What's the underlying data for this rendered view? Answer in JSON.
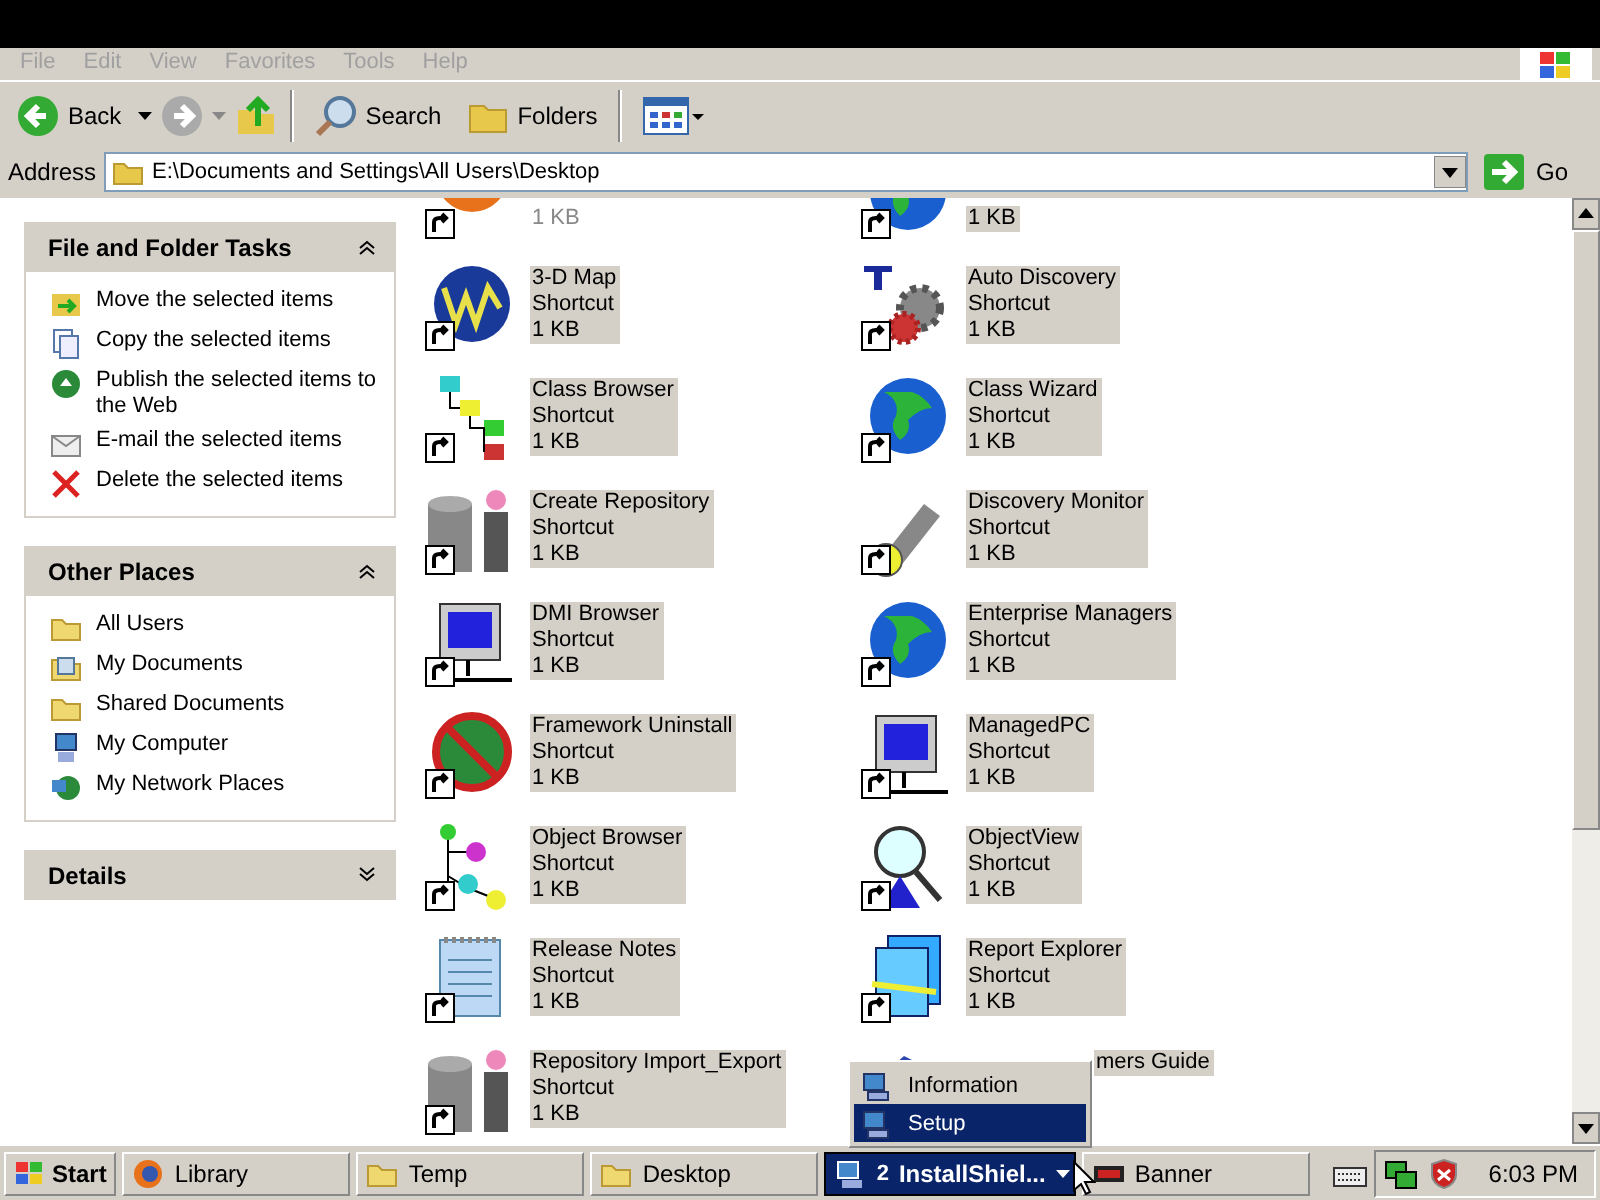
{
  "menu_bar": [
    "File",
    "Edit",
    "View",
    "Favorites",
    "Tools",
    "Help"
  ],
  "toolbar": {
    "back": "Back",
    "search": "Search",
    "folders": "Folders"
  },
  "address_bar": {
    "label": "Address",
    "value": "E:\\Documents and Settings\\All Users\\Desktop",
    "go": "Go"
  },
  "task_panes": [
    {
      "title": "File and Folder Tasks",
      "expanded": true,
      "items": [
        "Move the selected items",
        "Copy the selected items",
        "Publish the selected items to the Web",
        "E-mail the selected items",
        "Delete the selected items"
      ]
    },
    {
      "title": "Other Places",
      "expanded": true,
      "items": [
        "All Users",
        "My Documents",
        "Shared Documents",
        "My Computer",
        "My Network Places"
      ]
    },
    {
      "title": "Details",
      "expanded": false
    }
  ],
  "files": [
    {
      "size": "1 KB",
      "selected": false
    },
    {
      "size": "1 KB",
      "selected": true
    },
    {
      "name": "3-D Map",
      "type": "Shortcut",
      "size": "1 KB",
      "selected": true
    },
    {
      "name": "Auto Discovery",
      "type": "Shortcut",
      "size": "1 KB",
      "selected": true
    },
    {
      "name": "Class Browser",
      "type": "Shortcut",
      "size": "1 KB",
      "selected": true
    },
    {
      "name": "Class Wizard",
      "type": "Shortcut",
      "size": "1 KB",
      "selected": true
    },
    {
      "name": "Create Repository",
      "type": "Shortcut",
      "size": "1 KB",
      "selected": true
    },
    {
      "name": "Discovery Monitor",
      "type": "Shortcut",
      "size": "1 KB",
      "selected": true
    },
    {
      "name": "DMI Browser",
      "type": "Shortcut",
      "size": "1 KB",
      "selected": true
    },
    {
      "name": "Enterprise Managers",
      "type": "Shortcut",
      "size": "1 KB",
      "selected": true
    },
    {
      "name": "Framework Uninstall",
      "type": "Shortcut",
      "size": "1 KB",
      "selected": true
    },
    {
      "name": "ManagedPC",
      "type": "Shortcut",
      "size": "1 KB",
      "selected": true
    },
    {
      "name": "Object Browser",
      "type": "Shortcut",
      "size": "1 KB",
      "selected": true
    },
    {
      "name": "ObjectView",
      "type": "Shortcut",
      "size": "1 KB",
      "selected": true
    },
    {
      "name": "Release Notes",
      "type": "Shortcut",
      "size": "1 KB",
      "selected": true
    },
    {
      "name": "Report Explorer",
      "type": "Shortcut",
      "size": "1 KB",
      "selected": true
    },
    {
      "name": "Repository Import_Export",
      "type": "Shortcut",
      "size": "1 KB",
      "selected": true
    },
    {
      "name": "mers Guide",
      "selected": true
    }
  ],
  "context_menu": [
    {
      "label": "Information",
      "selected": false
    },
    {
      "label": "Setup",
      "selected": true
    }
  ],
  "taskbar": {
    "start": "Start",
    "buttons": [
      {
        "label": "Library",
        "active": false
      },
      {
        "label": "Temp",
        "active": false
      },
      {
        "label": "Desktop",
        "active": false
      },
      {
        "count": "2",
        "label": "InstallShiel...",
        "active": true
      },
      {
        "label": "Banner",
        "active": false
      }
    ],
    "clock": "6:03 PM"
  }
}
